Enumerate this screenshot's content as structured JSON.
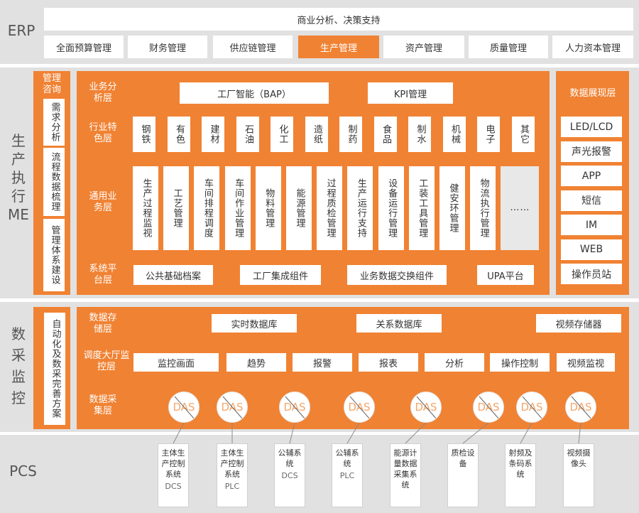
{
  "erp": {
    "label": "ERP",
    "top": "商业分析、决策支持",
    "modules": [
      "全面预算管理",
      "财务管理",
      "供应链管理",
      "生产管理",
      "资产管理",
      "质量管理",
      "人力资本管理"
    ]
  },
  "me": {
    "label": "生产执行ME",
    "left": {
      "title": "管理咨询",
      "items": [
        "需求分析",
        "流程数据梳理",
        "管理体系建设"
      ]
    },
    "business_layer": {
      "label": "业务分析层",
      "items": [
        "工厂智能（BAP）",
        "KPI管理"
      ]
    },
    "industry_layer": {
      "label": "行业特色层",
      "items": [
        "钢铁",
        "有色",
        "建材",
        "石油",
        "化工",
        "造纸",
        "制药",
        "食品",
        "制水",
        "机械",
        "电子",
        "其它"
      ]
    },
    "general_layer": {
      "label": "通用业务层",
      "items": [
        "生产过程监视",
        "工艺管理",
        "车间排程调度",
        "车间作业管理",
        "物料管理",
        "能源管理",
        "过程质检管理",
        "生产运行支持",
        "设备运行管理",
        "工装工具管理",
        "健安环管理",
        "物流执行管理",
        "……"
      ]
    },
    "platform_layer": {
      "label": "系统平台层",
      "items": [
        "公共基础档案",
        "工厂集成组件",
        "业务数据交换组件",
        "UPA平台"
      ]
    },
    "display": {
      "title": "数据展现层",
      "items": [
        "LED/LCD",
        "声光报警",
        "APP",
        "短信",
        "IM",
        "WEB",
        "操作员站"
      ]
    }
  },
  "scada": {
    "label": "数采监控",
    "left": "自动化及数采完善方案",
    "storage_layer": {
      "label": "数据存储层",
      "items": [
        "实时数据库",
        "关系数据库",
        "视频存储器"
      ]
    },
    "monitor_layer": {
      "label": "调度大厅监控层",
      "items": [
        "监控画面",
        "趋势",
        "报警",
        "报表",
        "分析",
        "操作控制",
        "视频监视"
      ]
    },
    "collect_layer": {
      "label": "数据采集层",
      "das": "DAS"
    }
  },
  "pcs": {
    "label": "PCS",
    "systems": [
      {
        "name": "主体生产控制系统",
        "sub": "DCS"
      },
      {
        "name": "主体生产控制系统",
        "sub": "PLC"
      },
      {
        "name": "公辅系统",
        "sub": "DCS"
      },
      {
        "name": "公辅系统",
        "sub": "PLC"
      },
      {
        "name": "能源计量数据采集系统",
        "sub": ""
      },
      {
        "name": "质检设备",
        "sub": ""
      },
      {
        "name": "射频及条码系统",
        "sub": ""
      },
      {
        "name": "视频摄像头",
        "sub": ""
      }
    ]
  }
}
